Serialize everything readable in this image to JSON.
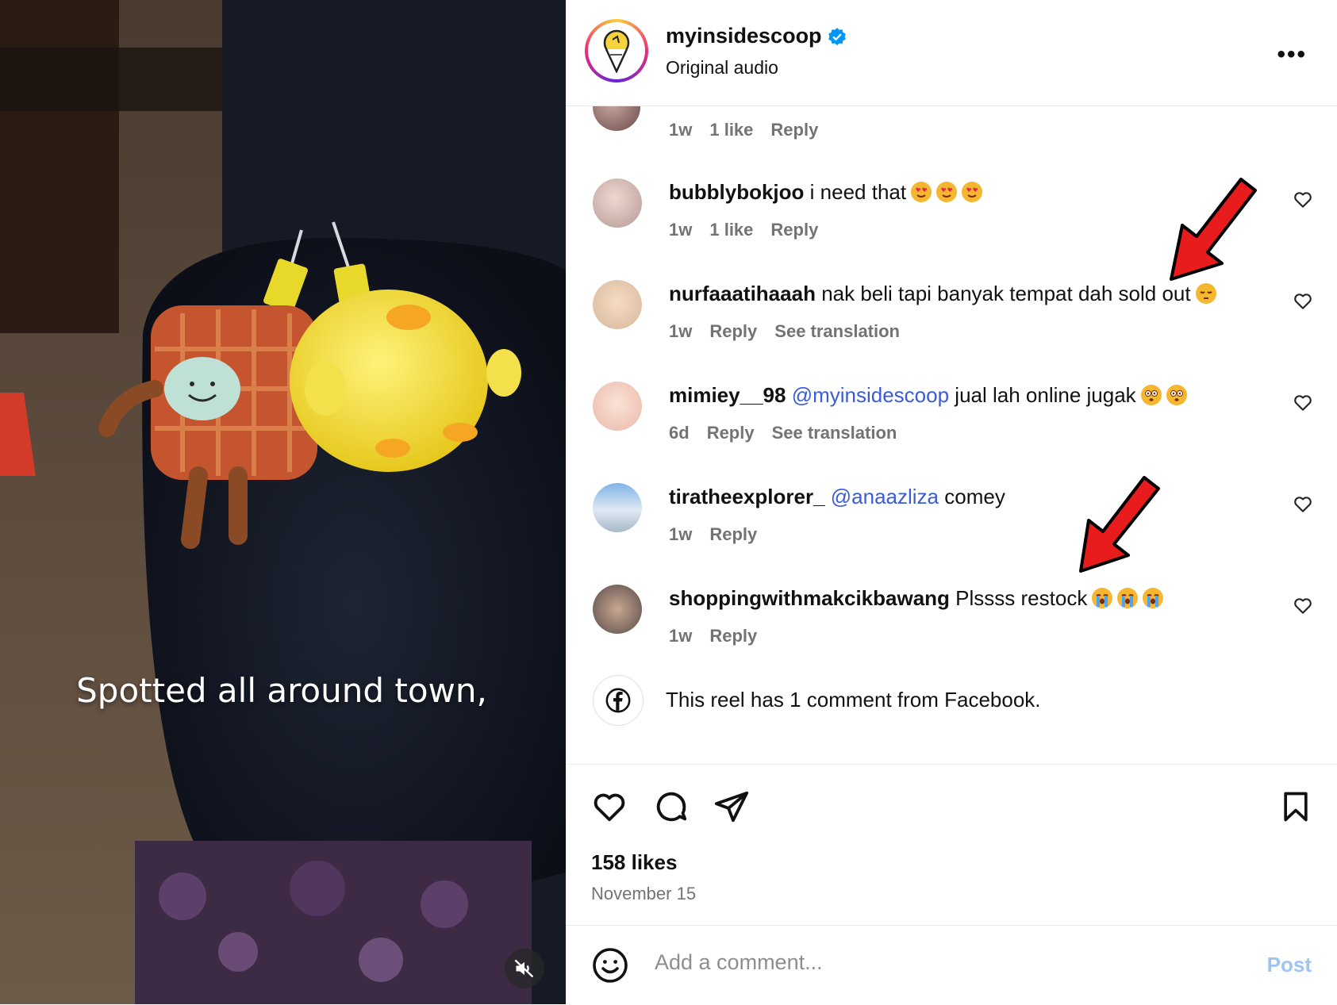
{
  "header": {
    "username": "myinsidescoop",
    "subtitle": "Original audio",
    "more_label": "•••"
  },
  "video": {
    "caption": "Spotted all around town,"
  },
  "partial_comment": {
    "time": "1w",
    "likes": "1 like",
    "reply": "Reply"
  },
  "comments": [
    {
      "username": "bubblybokjoo",
      "text": "i need that",
      "emoji": [
        "heart-eyes",
        "heart-eyes",
        "heart-eyes"
      ],
      "time": "1w",
      "likes": "1 like",
      "reply": "Reply"
    },
    {
      "username": "nurfaaatihaaah",
      "text": "nak beli tapi banyak tempat dah sold out",
      "emoji": [
        "pensive"
      ],
      "time": "1w",
      "reply": "Reply",
      "translation": "See translation"
    },
    {
      "username": "mimiey__98",
      "mention": "@myinsidescoop",
      "text": "jual lah online jugak",
      "emoji": [
        "flushed",
        "flushed"
      ],
      "time": "6d",
      "reply": "Reply",
      "translation": "See translation"
    },
    {
      "username": "tiratheexplorer_",
      "mention": "@anaazliza",
      "text": "comey",
      "time": "1w",
      "reply": "Reply"
    },
    {
      "username": "shoppingwithmakcikbawang",
      "text": "Plssss restock",
      "emoji": [
        "crying",
        "crying",
        "crying"
      ],
      "time": "1w",
      "reply": "Reply"
    }
  ],
  "facebook_note": "This reel has 1 comment from Facebook.",
  "stats": {
    "likes": "158 likes",
    "date": "November 15"
  },
  "composer": {
    "placeholder": "Add a comment...",
    "post_label": "Post"
  },
  "colors": {
    "mention": "#3b5bdb",
    "verified": "#0095f6",
    "post_button": "#9dc4f5",
    "annotation_arrow": "#e81c1c"
  }
}
